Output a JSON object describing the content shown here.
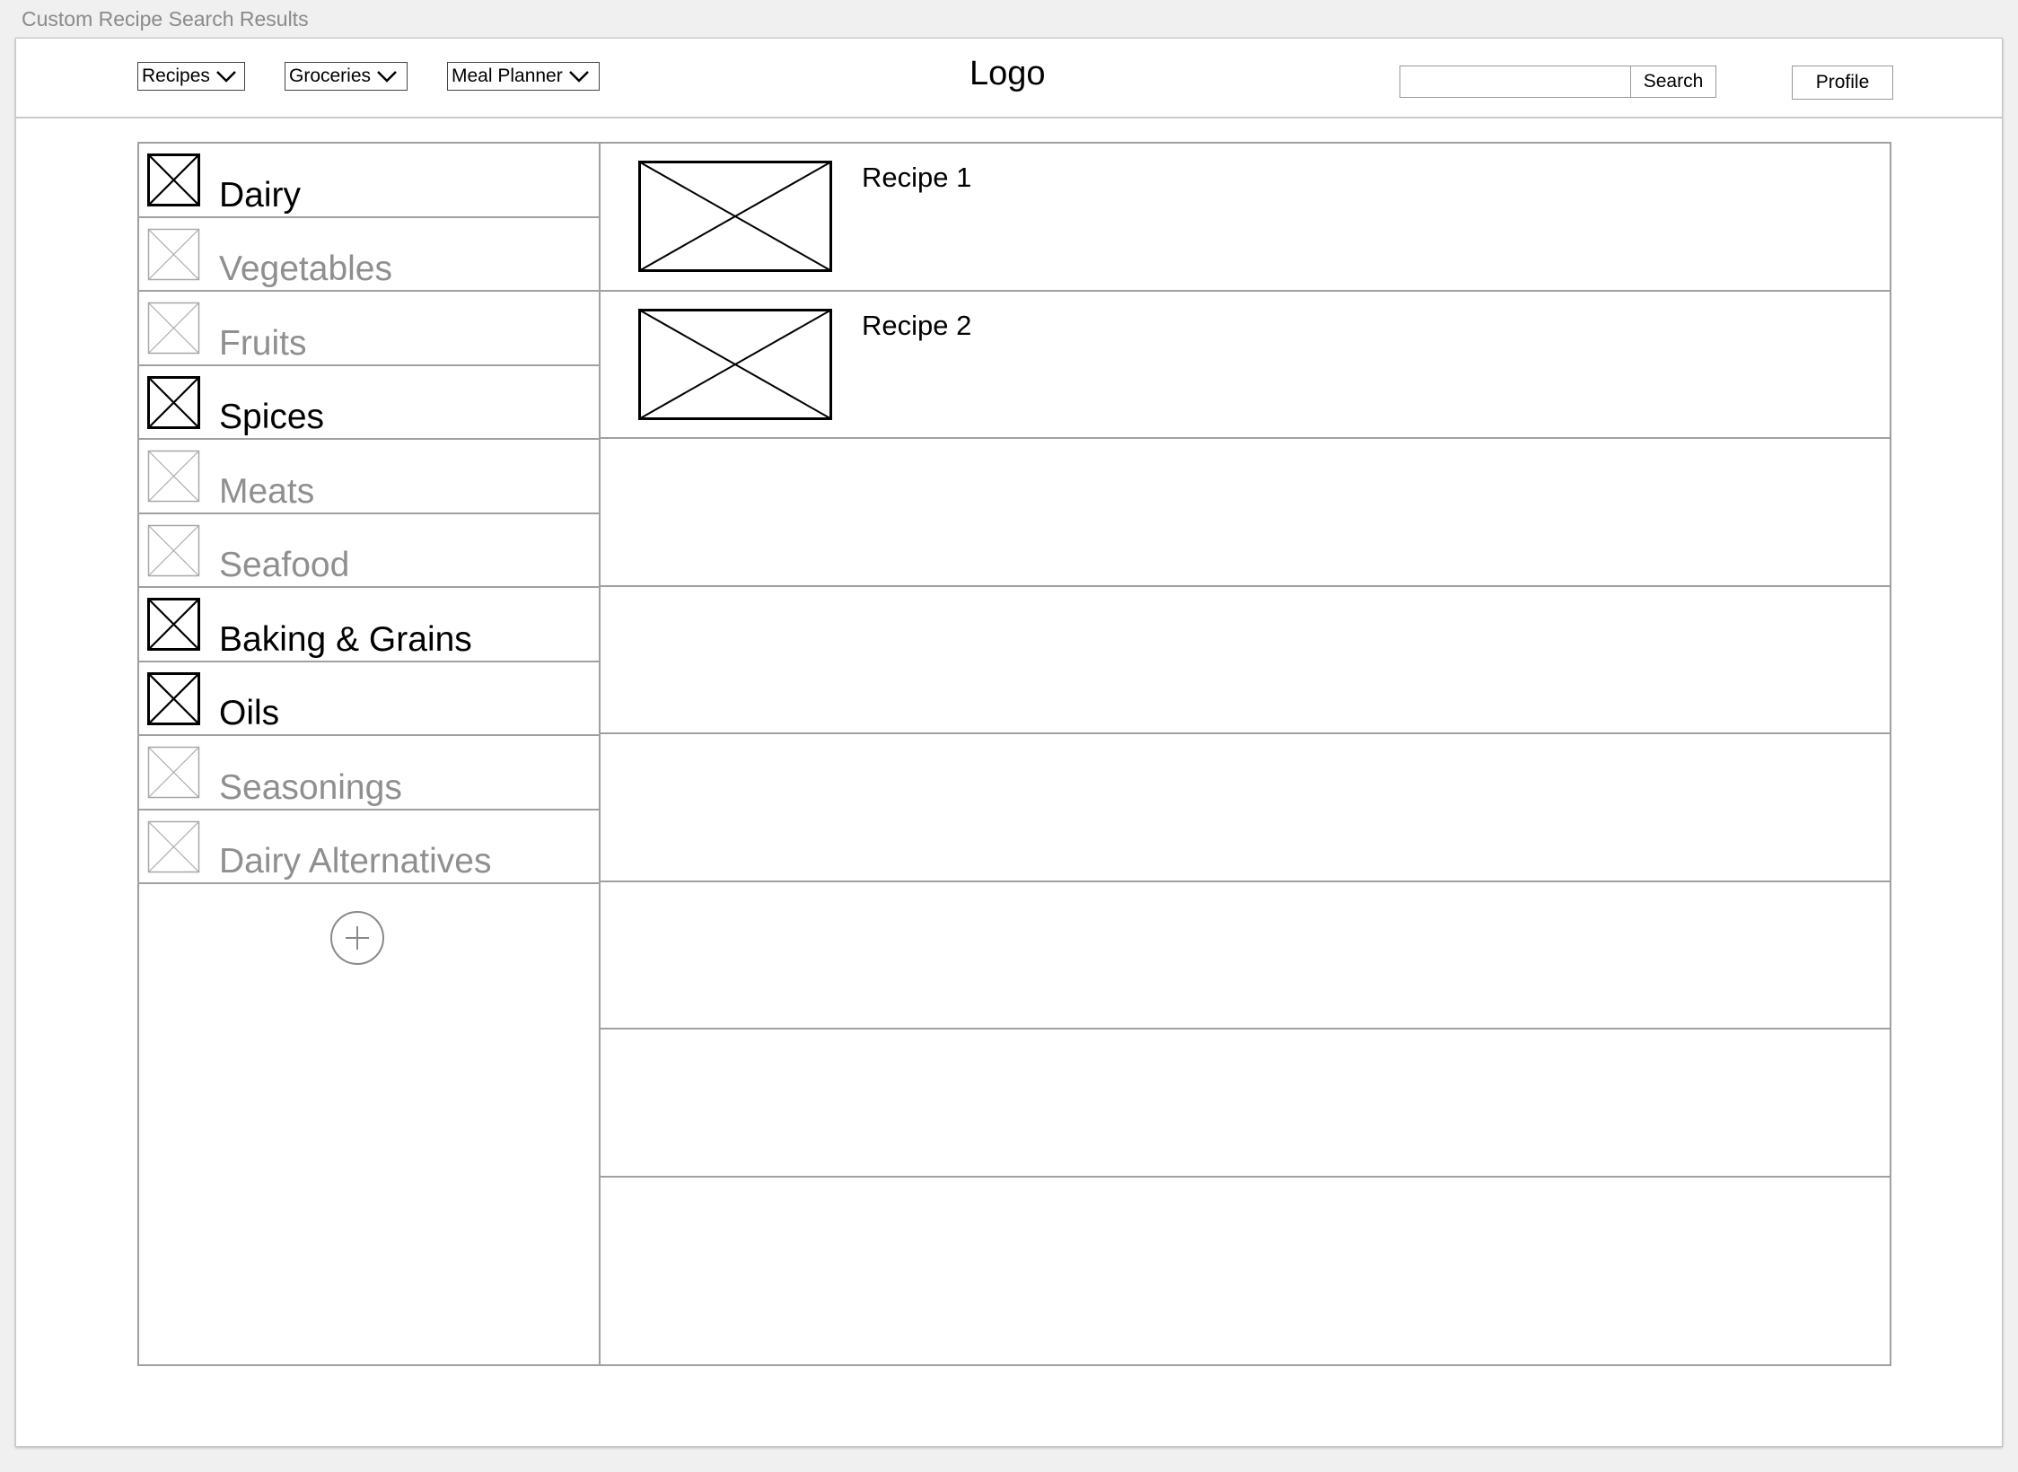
{
  "window": {
    "title": "Custom Recipe Search Results"
  },
  "nav": {
    "menus": [
      {
        "label": "Recipes"
      },
      {
        "label": "Groceries"
      },
      {
        "label": "Meal Planner"
      }
    ]
  },
  "header": {
    "logo": "Logo",
    "search": {
      "value": "",
      "placeholder": "",
      "button_label": "Search"
    },
    "profile_label": "Profile"
  },
  "categories": [
    {
      "label": "Dairy",
      "selected": true
    },
    {
      "label": "Vegetables",
      "selected": false
    },
    {
      "label": "Fruits",
      "selected": false
    },
    {
      "label": "Spices",
      "selected": true
    },
    {
      "label": "Meats",
      "selected": false
    },
    {
      "label": "Seafood",
      "selected": false
    },
    {
      "label": "Baking & Grains",
      "selected": true
    },
    {
      "label": "Oils",
      "selected": true
    },
    {
      "label": "Seasonings",
      "selected": false
    },
    {
      "label": "Dairy Alternatives",
      "selected": false
    }
  ],
  "results": [
    {
      "title": "Recipe 1",
      "image": "image-placeholder-icon"
    },
    {
      "title": "Recipe 2",
      "image": "image-placeholder-icon"
    },
    {
      "title": "",
      "image": ""
    },
    {
      "title": "",
      "image": ""
    },
    {
      "title": "",
      "image": ""
    },
    {
      "title": "",
      "image": ""
    },
    {
      "title": "",
      "image": ""
    },
    {
      "title": "",
      "image": ""
    }
  ],
  "colors": {
    "selected": "#000000",
    "unselected": "#8f8f8f",
    "border": "#a0a0a0"
  }
}
